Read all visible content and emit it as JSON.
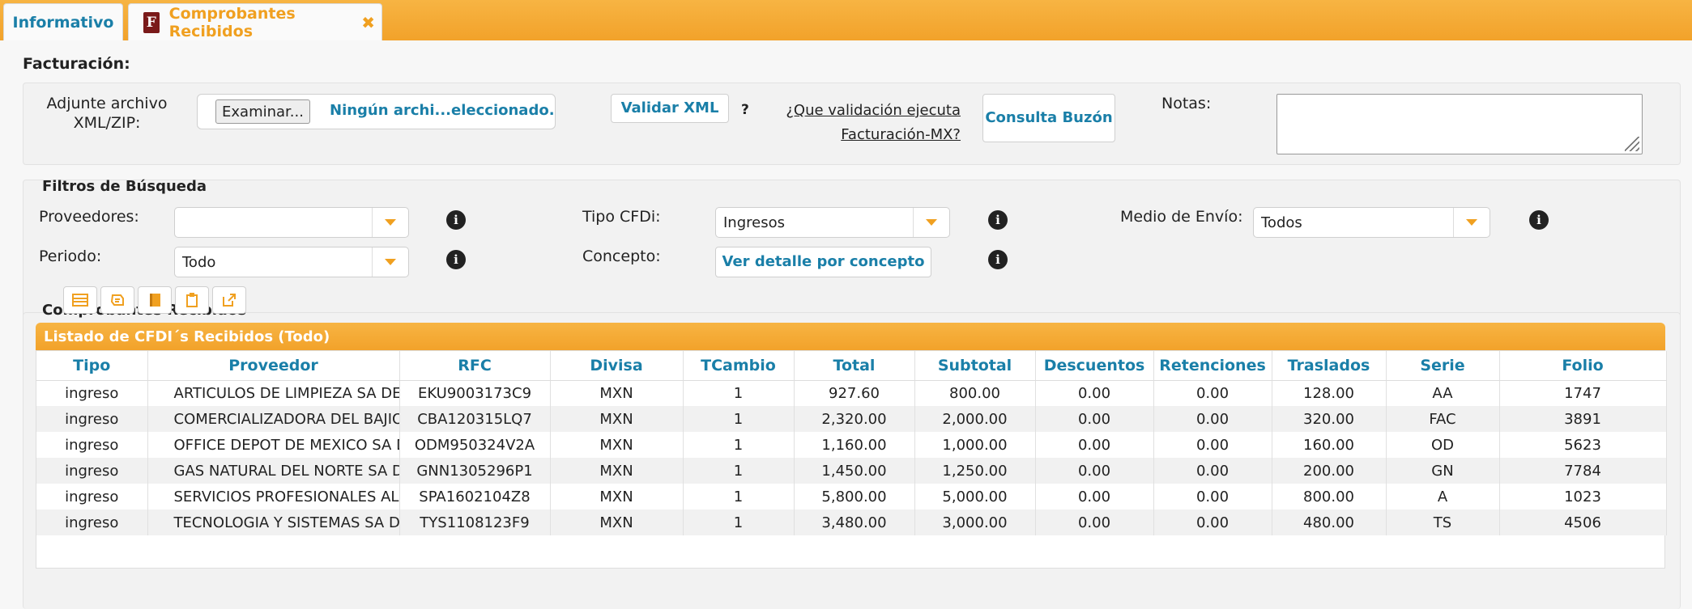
{
  "tabs": [
    {
      "label": "Informativo"
    },
    {
      "label": "Comprobantes Recibidos",
      "icon_letter": "F"
    }
  ],
  "facturacion": {
    "title": "Facturación:",
    "attach_label": "Adjunte archivo XML/ZIP:",
    "browse_label": "Examinar...",
    "file_status": "Ningún archi...eleccionado.",
    "validate_label": "Validar XML",
    "help_mark": "?",
    "help_link": "¿Que validación ejecuta Facturación-MX?",
    "mailbox_label": "Consulta Buzón",
    "notes_label": "Notas:",
    "notes_value": ""
  },
  "filters": {
    "title": "Filtros de Búsqueda",
    "proveedores_label": "Proveedores:",
    "proveedores_value": "",
    "tipo_label": "Tipo CFDi:",
    "tipo_value": "Ingresos",
    "medio_label": "Medio de Envío:",
    "medio_value": "Todos",
    "periodo_label": "Periodo:",
    "periodo_value": "Todo",
    "concepto_label": "Concepto:",
    "concepto_button": "Ver detalle por concepto"
  },
  "grid": {
    "section_title": "Comprobantes Recibidos",
    "toolbar": [
      "table-icon",
      "refresh-icon",
      "book-icon",
      "clipboard-icon",
      "export-icon"
    ],
    "title": "Listado de CFDI´s Recibidos (Todo)",
    "columns": [
      "Tipo",
      "Proveedor",
      "RFC",
      "Divisa",
      "TCambio",
      "Total",
      "Subtotal",
      "Descuentos",
      "Retenciones",
      "Traslados",
      "Serie",
      "Folio"
    ],
    "rows": [
      [
        "ingreso",
        "ARTICULOS DE LIMPIEZA SA DE CV",
        "EKU9003173C9",
        "MXN",
        "1",
        "927.60",
        "800.00",
        "0.00",
        "0.00",
        "128.00",
        "AA",
        "1747"
      ],
      [
        "ingreso",
        "COMERCIALIZADORA DEL BAJIO SA DE CV",
        "CBA120315LQ7",
        "MXN",
        "1",
        "2,320.00",
        "2,000.00",
        "0.00",
        "0.00",
        "320.00",
        "FAC",
        "3891"
      ],
      [
        "ingreso",
        "OFFICE DEPOT DE MEXICO SA DE CV",
        "ODM950324V2A",
        "MXN",
        "1",
        "1,160.00",
        "1,000.00",
        "0.00",
        "0.00",
        "160.00",
        "OD",
        "5623"
      ],
      [
        "ingreso",
        "GAS NATURAL DEL NORTE SA DE CV",
        "GNN1305296P1",
        "MXN",
        "1",
        "1,450.00",
        "1,250.00",
        "0.00",
        "0.00",
        "200.00",
        "GN",
        "7784"
      ],
      [
        "ingreso",
        "SERVICIOS PROFESIONALES ALFA SC",
        "SPA1602104Z8",
        "MXN",
        "1",
        "5,800.00",
        "5,000.00",
        "0.00",
        "0.00",
        "800.00",
        "A",
        "1023"
      ],
      [
        "ingreso",
        "TECNOLOGIA Y SISTEMAS SA DE CV",
        "TYS1108123F9",
        "MXN",
        "1",
        "3,480.00",
        "3,000.00",
        "0.00",
        "0.00",
        "480.00",
        "TS",
        "4506"
      ]
    ]
  },
  "colors": {
    "accent": "#f2a22a",
    "link": "#1a7fa8",
    "brand_icon": "#7a1a1a"
  }
}
